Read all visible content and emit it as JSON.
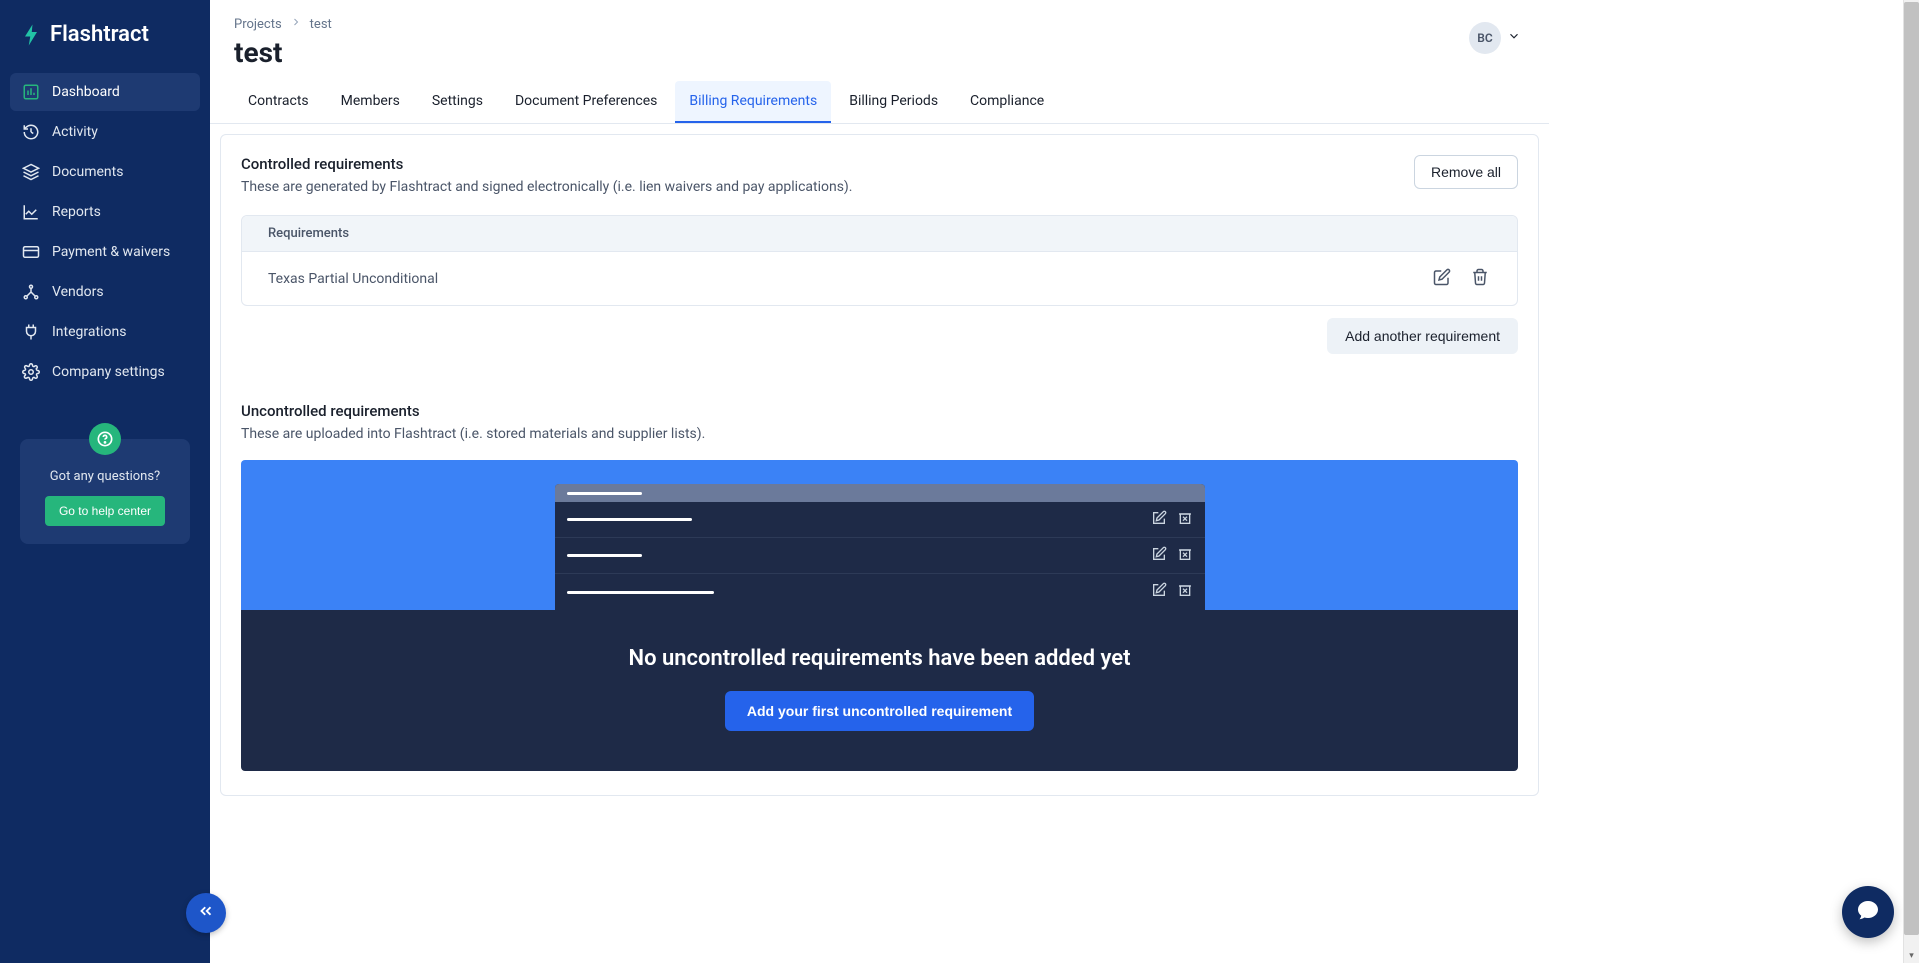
{
  "brand": {
    "name": "Flashtract"
  },
  "sidebar": {
    "items": [
      {
        "label": "Dashboard"
      },
      {
        "label": "Activity"
      },
      {
        "label": "Documents"
      },
      {
        "label": "Reports"
      },
      {
        "label": "Payment & waivers"
      },
      {
        "label": "Vendors"
      },
      {
        "label": "Integrations"
      },
      {
        "label": "Company settings"
      }
    ],
    "help": {
      "question": "Got any questions?",
      "button": "Go to help center"
    }
  },
  "breadcrumbs": {
    "root": "Projects",
    "current": "test"
  },
  "page": {
    "title": "test"
  },
  "user": {
    "initials": "BC"
  },
  "tabs": [
    {
      "label": "Contracts"
    },
    {
      "label": "Members"
    },
    {
      "label": "Settings"
    },
    {
      "label": "Document Preferences"
    },
    {
      "label": "Billing Requirements"
    },
    {
      "label": "Billing Periods"
    },
    {
      "label": "Compliance"
    }
  ],
  "controlled": {
    "title": "Controlled requirements",
    "desc": "These are generated by Flashtract and signed electronically (i.e. lien waivers and pay applications).",
    "remove_all": "Remove all",
    "column_header": "Requirements",
    "rows": [
      {
        "name": "Texas Partial Unconditional"
      }
    ],
    "add_button": "Add another requirement"
  },
  "uncontrolled": {
    "title": "Uncontrolled requirements",
    "desc": "These are uploaded into Flashtract (i.e. stored materials and supplier lists).",
    "empty_title": "No uncontrolled requirements have been added yet",
    "empty_button": "Add your first uncontrolled requirement"
  }
}
